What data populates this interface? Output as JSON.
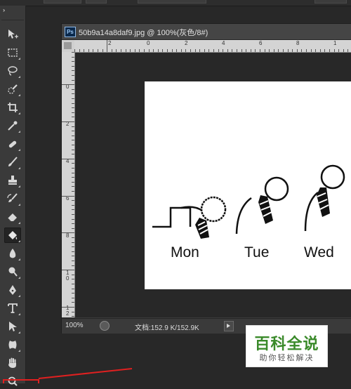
{
  "document": {
    "title": "50b9a14a8daf9.jpg @ 100%(灰色/8#)",
    "ps_badge": "Ps"
  },
  "rulers": {
    "top_labels": [
      "2",
      "0",
      "2",
      "4",
      "6",
      "8",
      "1"
    ],
    "left_labels": [
      "0",
      "2",
      "4",
      "6",
      "8",
      "1\n0",
      "1\n2"
    ]
  },
  "image": {
    "days": [
      "Mon",
      "Tue",
      "Wed"
    ]
  },
  "status": {
    "zoom": "100%",
    "doc_size": "文档:152.9 K/152.9K"
  },
  "tools": [
    {
      "name": "move-tool"
    },
    {
      "name": "marquee-tool"
    },
    {
      "name": "lasso-tool"
    },
    {
      "name": "quick-selection-tool"
    },
    {
      "name": "crop-tool"
    },
    {
      "name": "eyedropper-tool"
    },
    {
      "name": "healing-brush-tool"
    },
    {
      "name": "brush-tool"
    },
    {
      "name": "clone-stamp-tool"
    },
    {
      "name": "history-brush-tool"
    },
    {
      "name": "eraser-tool"
    },
    {
      "name": "paint-bucket-tool",
      "active": true
    },
    {
      "name": "blur-tool"
    },
    {
      "name": "dodge-tool"
    },
    {
      "name": "pen-tool"
    },
    {
      "name": "type-tool"
    },
    {
      "name": "path-selection-tool"
    },
    {
      "name": "custom-shape-tool"
    },
    {
      "name": "hand-tool"
    },
    {
      "name": "zoom-tool"
    }
  ],
  "watermark": {
    "main": "百科全说",
    "sub": "助你轻松解决",
    "color": "#3a8a2a"
  },
  "colors": {
    "annotation": "#e02020",
    "workspace": "#282828",
    "panel": "#3a3a3a"
  }
}
